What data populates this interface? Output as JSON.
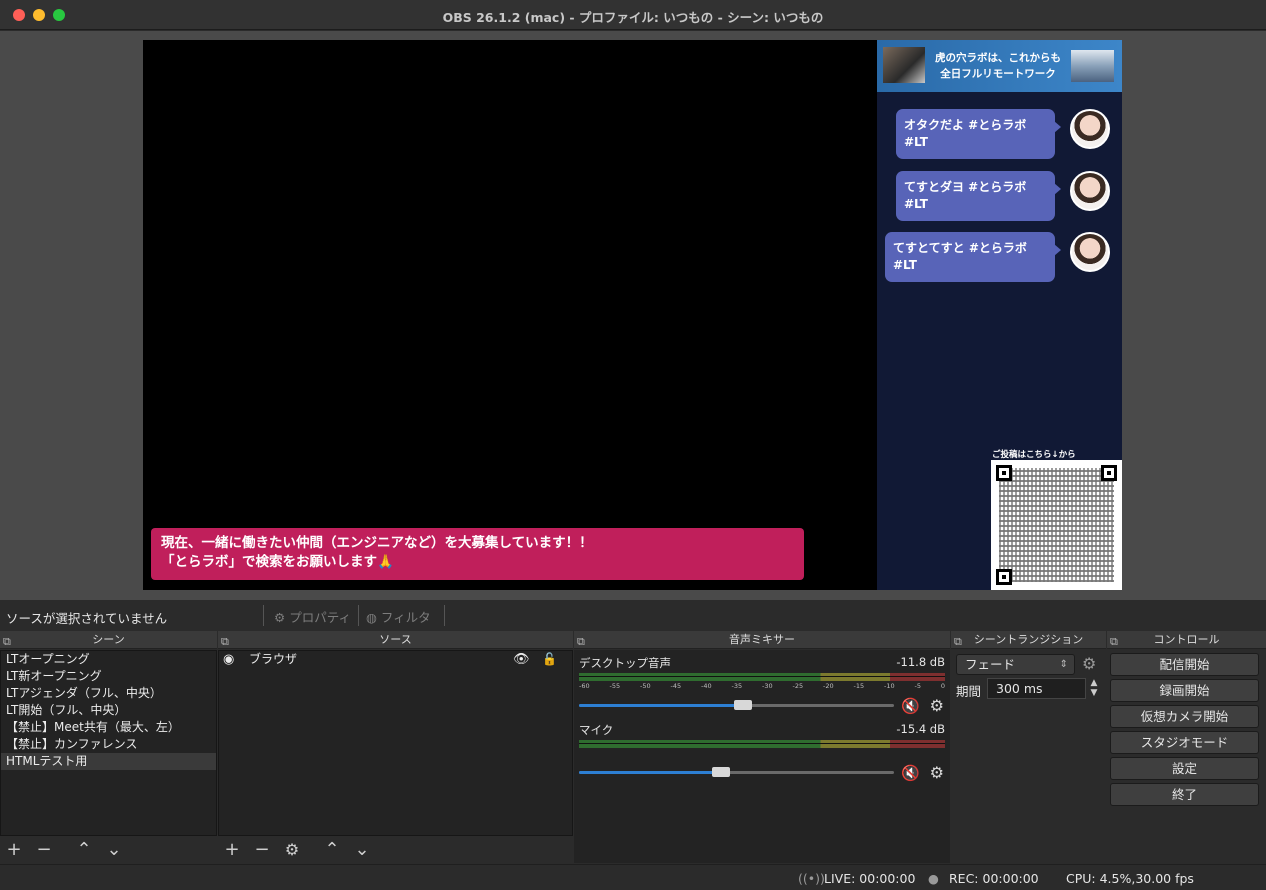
{
  "window": {
    "title": "OBS 26.1.2 (mac) - プロファイル: いつもの - シーン: いつもの"
  },
  "preview": {
    "banner": {
      "line1": "虎の穴ラボは、これからも",
      "line2": "全日フルリモートワーク"
    },
    "chat": [
      {
        "text": "オタクだよ #とらラボ #LT"
      },
      {
        "text": "てすとダヨ #とらラボ #LT"
      },
      {
        "text": "てすとてすと #とらラボ #LT"
      }
    ],
    "qr_label": "ご投稿はこちら↓から",
    "ticker": {
      "line1": "現在、一緒に働きたい仲間（エンジニアなど）を大募集しています！！",
      "line2": "「とらラボ」で検索をお願いします🙏"
    }
  },
  "toolbar": {
    "no_source": "ソースが選択されていません",
    "properties": "プロパティ",
    "filters": "フィルタ"
  },
  "scenes": {
    "header": "シーン",
    "items": [
      "LTオープニング",
      "LT新オープニング",
      "LTアジェンダ（フル、中央）",
      "LT開始（フル、中央）",
      "【禁止】Meet共有（最大、左）",
      "【禁止】カンファレンス",
      "HTMLテスト用"
    ],
    "selected_index": 6
  },
  "sources": {
    "header": "ソース",
    "items": [
      {
        "label": "ブラウザ",
        "icon": "globe-icon"
      }
    ]
  },
  "mixer": {
    "header": "音声ミキサー",
    "channels": [
      {
        "name": "デスクトップ音声",
        "db": "-11.8 dB",
        "volume": 0.52
      },
      {
        "name": "マイク",
        "db": "-15.4 dB",
        "volume": 0.45
      }
    ],
    "scale": [
      "-60",
      "-55",
      "-50",
      "-45",
      "-40",
      "-35",
      "-30",
      "-25",
      "-20",
      "-15",
      "-10",
      "-5",
      "0"
    ]
  },
  "transitions": {
    "header": "シーントランジション",
    "selected": "フェード",
    "duration_label": "期間",
    "duration_value": "300 ms"
  },
  "controls": {
    "header": "コントロール",
    "buttons": [
      "配信開始",
      "録画開始",
      "仮想カメラ開始",
      "スタジオモード",
      "設定",
      "終了"
    ]
  },
  "statusbar": {
    "live": "LIVE: 00:00:00",
    "rec": "REC: 00:00:00",
    "cpu": "CPU: 4.5%,30.00 fps"
  },
  "colors": {
    "ticker": "#c01f5b",
    "bubble": "#5864b8",
    "slider": "#2d7fd3",
    "mute": "#e0303a"
  }
}
